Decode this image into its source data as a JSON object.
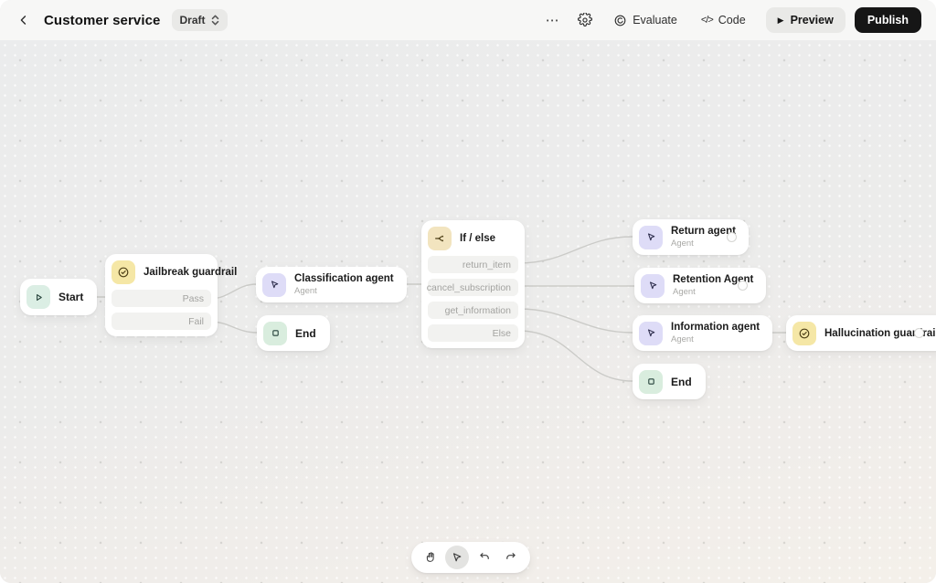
{
  "header": {
    "title": "Customer service",
    "status_label": "Draft",
    "evaluate_label": "Evaluate",
    "code_label": "Code",
    "preview_label": "Preview",
    "publish_label": "Publish"
  },
  "icons": {
    "more": "⋯",
    "code_glyph": "</>",
    "play_glyph": "▶"
  },
  "canvas": {
    "nodes": {
      "start": {
        "label": "Start"
      },
      "jailbreak_guardrail": {
        "title": "Jailbreak guardrail",
        "rows": [
          "Pass",
          "Fail"
        ]
      },
      "classification_agent": {
        "title": "Classification agent",
        "subtitle": "Agent"
      },
      "end_1": {
        "label": "End"
      },
      "if_else": {
        "title": "If / else",
        "rows": [
          "return_item",
          "cancel_subscription",
          "get_information",
          "Else"
        ]
      },
      "return_agent": {
        "title": "Return agent",
        "subtitle": "Agent"
      },
      "retention_agent": {
        "title": "Retention Agent",
        "subtitle": "Agent"
      },
      "information_agent": {
        "title": "Information agent",
        "subtitle": "Agent"
      },
      "end_2": {
        "label": "End"
      },
      "hallucination_guardrail": {
        "title": "Hallucination guardrail"
      }
    }
  },
  "colors": {
    "accent_mint": "#dbeee4",
    "accent_green": "#d9edde",
    "accent_lavender": "#dedcf7",
    "accent_yellow": "#f5e7a6",
    "accent_cream": "#f2e4bf",
    "publish_bg": "#161616",
    "edge": "#cbcbc8"
  }
}
